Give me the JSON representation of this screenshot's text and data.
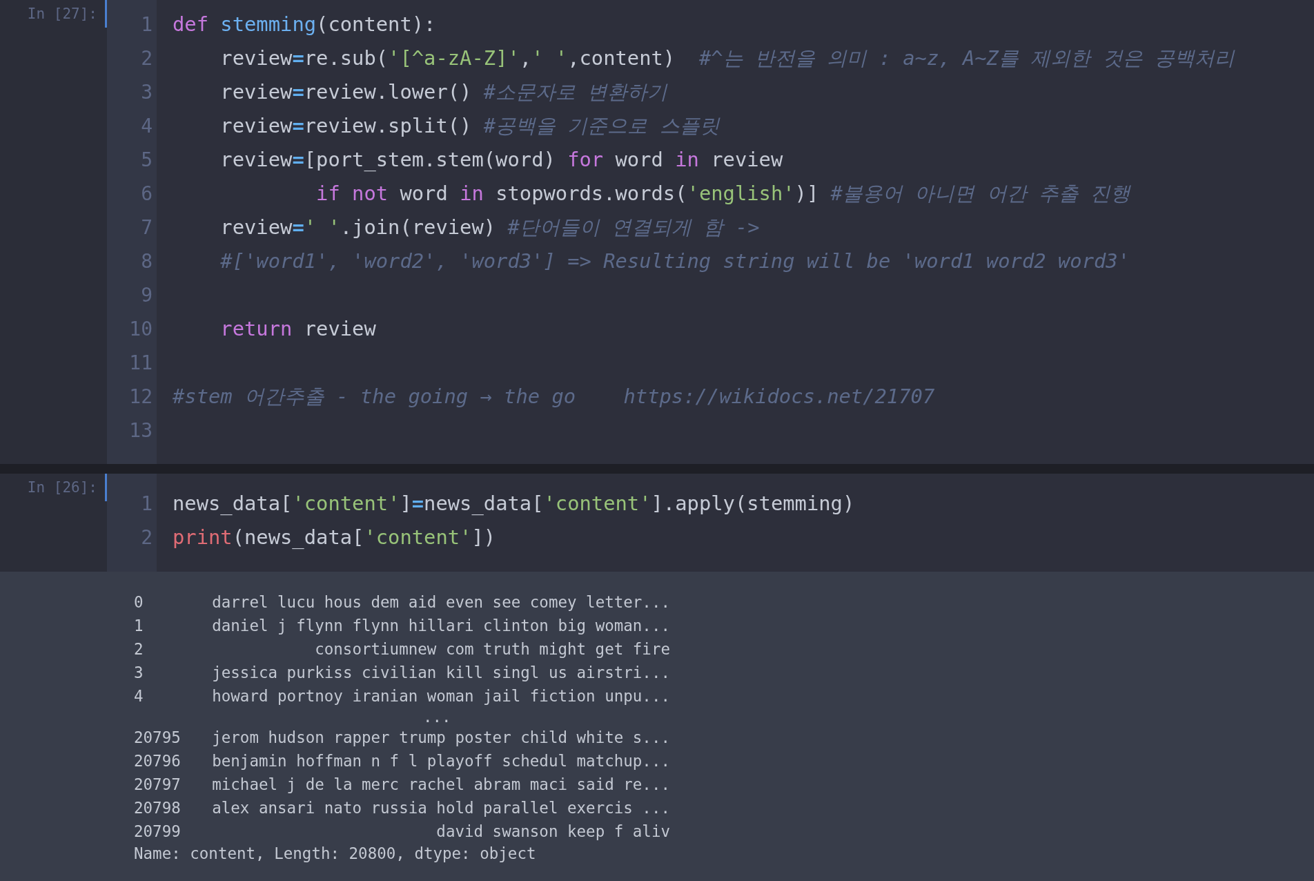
{
  "cells": [
    {
      "prompt": "In [27]:",
      "lines": [
        {
          "number": "1",
          "tokens": [
            {
              "kind": "keyword",
              "text": "def"
            },
            {
              "kind": "function",
              "text": " stemming"
            },
            {
              "kind": "plain",
              "text": "(content):"
            }
          ]
        },
        {
          "number": "2",
          "tokens": [
            {
              "kind": "plain",
              "text": "    review"
            },
            {
              "kind": "operator",
              "text": "="
            },
            {
              "kind": "plain",
              "text": "re.sub("
            },
            {
              "kind": "string",
              "text": "'[^a-zA-Z]'"
            },
            {
              "kind": "plain",
              "text": ","
            },
            {
              "kind": "string",
              "text": "' '"
            },
            {
              "kind": "plain",
              "text": ",content)  "
            },
            {
              "kind": "comment",
              "text": "#^는 반전을 의미 : a~z, A~Z를 제외한 것은 공백처리"
            }
          ]
        },
        {
          "number": "3",
          "tokens": [
            {
              "kind": "plain",
              "text": "    review"
            },
            {
              "kind": "operator",
              "text": "="
            },
            {
              "kind": "plain",
              "text": "review.lower() "
            },
            {
              "kind": "comment",
              "text": "#소문자로 변환하기"
            }
          ]
        },
        {
          "number": "4",
          "tokens": [
            {
              "kind": "plain",
              "text": "    review"
            },
            {
              "kind": "operator",
              "text": "="
            },
            {
              "kind": "plain",
              "text": "review.split() "
            },
            {
              "kind": "comment",
              "text": "#공백을 기준으로 스플릿"
            }
          ]
        },
        {
          "number": "5",
          "tokens": [
            {
              "kind": "plain",
              "text": "    review"
            },
            {
              "kind": "operator",
              "text": "="
            },
            {
              "kind": "plain",
              "text": "[port_stem.stem(word) "
            },
            {
              "kind": "keyword",
              "text": "for"
            },
            {
              "kind": "plain",
              "text": " word "
            },
            {
              "kind": "keyword",
              "text": "in"
            },
            {
              "kind": "plain",
              "text": " review"
            }
          ]
        },
        {
          "number": "6",
          "tokens": [
            {
              "kind": "keyword",
              "text": "            if"
            },
            {
              "kind": "keyword",
              "text": " not"
            },
            {
              "kind": "plain",
              "text": " word "
            },
            {
              "kind": "keyword",
              "text": "in"
            },
            {
              "kind": "plain",
              "text": " stopwords.words("
            },
            {
              "kind": "string",
              "text": "'english'"
            },
            {
              "kind": "plain",
              "text": ")] "
            },
            {
              "kind": "comment",
              "text": "#불용어 아니면 어간 추출 진행"
            }
          ]
        },
        {
          "number": "7",
          "tokens": [
            {
              "kind": "plain",
              "text": "    review"
            },
            {
              "kind": "operator",
              "text": "="
            },
            {
              "kind": "string",
              "text": "' '"
            },
            {
              "kind": "plain",
              "text": ".join(review) "
            },
            {
              "kind": "comment",
              "text": "#단어들이 연결되게 함 ->"
            }
          ]
        },
        {
          "number": "8",
          "tokens": [
            {
              "kind": "comment",
              "text": "    #['word1', 'word2', 'word3'] => Resulting string will be 'word1 word2 word3'"
            }
          ]
        },
        {
          "number": "9"
        },
        {
          "number": "10",
          "tokens": [
            {
              "kind": "keyword",
              "text": "    return"
            },
            {
              "kind": "plain",
              "text": " review"
            }
          ]
        },
        {
          "number": "11"
        },
        {
          "number": "12",
          "tokens": [
            {
              "kind": "comment",
              "text": "#stem 어간추출 - the going → the go    https://wikidocs.net/21707"
            }
          ]
        },
        {
          "number": "13"
        }
      ]
    },
    {
      "prompt": "In [26]:",
      "lines": [
        {
          "number": "1",
          "tokens": [
            {
              "kind": "plain",
              "text": "news_data["
            },
            {
              "kind": "string",
              "text": "'content'"
            },
            {
              "kind": "plain",
              "text": "]"
            },
            {
              "kind": "operator",
              "text": "="
            },
            {
              "kind": "plain",
              "text": "news_data["
            },
            {
              "kind": "string",
              "text": "'content'"
            },
            {
              "kind": "plain",
              "text": "].apply(stemming)"
            }
          ]
        },
        {
          "number": "2",
          "tokens": [
            {
              "kind": "builtin",
              "text": "print"
            },
            {
              "kind": "plain",
              "text": "(news_data["
            },
            {
              "kind": "string",
              "text": "'content'"
            },
            {
              "kind": "plain",
              "text": "])"
            }
          ]
        }
      ]
    }
  ],
  "output": {
    "rows": [
      {
        "index": "0",
        "text": "darrel lucu hous dem aid even see comey letter..."
      },
      {
        "index": "1",
        "text": "daniel j flynn flynn hillari clinton big woman..."
      },
      {
        "index": "2",
        "text": "consortiumnew com truth might get fire"
      },
      {
        "index": "3",
        "text": "jessica purkiss civilian kill singl us airstri..."
      },
      {
        "index": "4",
        "text": "howard portnoy iranian woman jail fiction unpu..."
      },
      {
        "ellipsis": "..."
      },
      {
        "index": "20795",
        "text": "jerom hudson rapper trump poster child white s..."
      },
      {
        "index": "20796",
        "text": "benjamin hoffman n f l playoff schedul matchup..."
      },
      {
        "index": "20797",
        "text": "michael j de la merc rachel abram maci said re..."
      },
      {
        "index": "20798",
        "text": "alex ansari nato russia hold parallel exercis ..."
      },
      {
        "index": "20799",
        "text": "david swanson keep f aliv"
      }
    ],
    "footer": "Name: content, Length: 20800, dtype: object"
  }
}
